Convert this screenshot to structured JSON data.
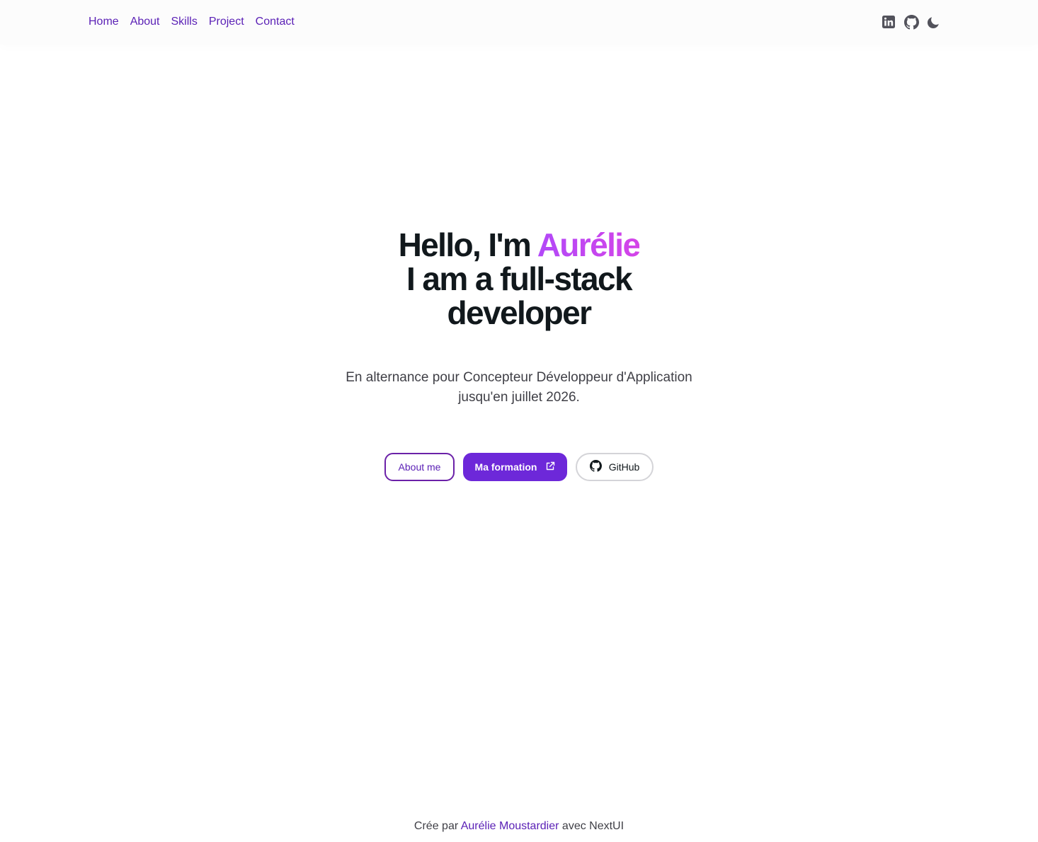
{
  "nav": {
    "links": [
      "Home",
      "About",
      "Skills",
      "Project",
      "Contact"
    ],
    "icons": [
      "linkedin-icon",
      "github-icon",
      "moon-icon"
    ]
  },
  "hero": {
    "title_prefix": "Hello, I'm ",
    "name": "Aurélie",
    "title_line2": "I am a full-stack",
    "title_line3": "developer",
    "subtitle": "En alternance pour Concepteur Développeur d'Application jusqu'en juillet 2026.",
    "buttons": {
      "about": "About me",
      "formation": "Ma formation",
      "github": "GitHub"
    }
  },
  "footer": {
    "prefix": "Crée par ",
    "author": "Aurélie Moustardier",
    "suffix": " avec NextUI"
  },
  "colors": {
    "link": "#5b21b6",
    "primary": "#6d28d9",
    "accent_gradient": [
      "#b249f8",
      "#d444e8"
    ]
  }
}
